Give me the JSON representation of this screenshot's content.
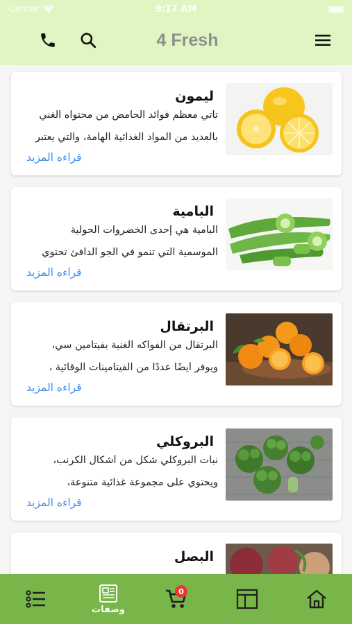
{
  "status_bar": {
    "carrier": "Carrier",
    "time": "9:17 AM"
  },
  "header": {
    "title": "4 Fresh",
    "icons": {
      "phone": "phone-icon",
      "search": "search-icon",
      "menu": "menu-icon"
    }
  },
  "products": [
    {
      "title": "ليمون",
      "line1": "تأتي معظم فوائد الحامض من محتواه الغني",
      "line2": "بالعديد من المواد الغذائية الهامة، والتي يعتبر",
      "read_more": "قراءه المزيد",
      "image": "lemons"
    },
    {
      "title": "البامية",
      "line1": "البامية هي إحدى الخضروات الحولية",
      "line2": "الموسمية التي تنمو في الجو الدافئ تحتوي",
      "read_more": "قراءه المزيد",
      "image": "okra"
    },
    {
      "title": "البرتقال",
      "line1": "البرتقال من الفواكه الغنية بفيتامين سي،",
      "line2": "ويوفر أيضًا عددًا من الفيتامينات الوقائية ،",
      "read_more": "قراءه المزيد",
      "image": "oranges"
    },
    {
      "title": "البروكلي",
      "line1": "نبات البروكلي شكل من أشكال الكرنب،",
      "line2": "ويحتوي على مجموعة غذائية متنوعة،",
      "read_more": "قراءه المزيد",
      "image": "broccoli"
    },
    {
      "title": "البصل",
      "line1": "",
      "line2": "",
      "read_more": "",
      "image": "onions"
    }
  ],
  "bottom_nav": {
    "items": [
      {
        "icon": "list-icon",
        "label": ""
      },
      {
        "icon": "recipes-icon",
        "label": "وصفات"
      },
      {
        "icon": "cart-icon",
        "label": "",
        "badge": "0"
      },
      {
        "icon": "layout-icon",
        "label": ""
      },
      {
        "icon": "home-icon",
        "label": ""
      }
    ]
  },
  "colors": {
    "header_bg": "#dff5c2",
    "nav_bg": "#79b64a",
    "link": "#3d8ee8",
    "badge": "#e53935"
  }
}
